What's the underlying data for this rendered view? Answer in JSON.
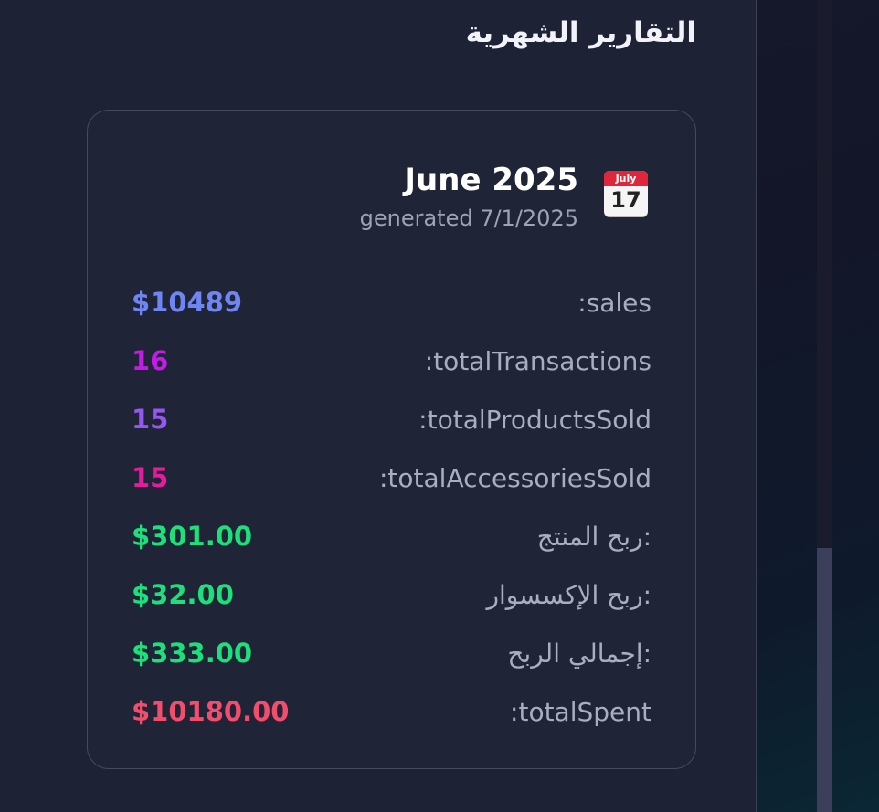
{
  "page": {
    "title": "التقارير الشهرية"
  },
  "report": {
    "title": "June 2025",
    "subtitle": "generated 7/1/2025",
    "icon": "calendar-icon",
    "icon_month": "July",
    "icon_day": "17",
    "stats": [
      {
        "label": ":sales",
        "value": "$10489",
        "color": "#6f86f2"
      },
      {
        "label": ":totalTransactions",
        "value": "16",
        "color": "#c41be8"
      },
      {
        "label": ":totalProductsSold",
        "value": "15",
        "color": "#9656f2"
      },
      {
        "label": ":totalAccessoriesSold",
        "value": "15",
        "color": "#e51c9e"
      },
      {
        "label": "ربح المنتج:",
        "value": "$301.00",
        "color": "#1ee07a"
      },
      {
        "label": "ربح الإكسسوار:",
        "value": "$32.00",
        "color": "#1ee07a"
      },
      {
        "label": "إجمالي الربح:",
        "value": "$333.00",
        "color": "#1ee07a"
      },
      {
        "label": ":totalSpent",
        "value": "$10180.00",
        "color": "#f24d6d"
      }
    ]
  }
}
